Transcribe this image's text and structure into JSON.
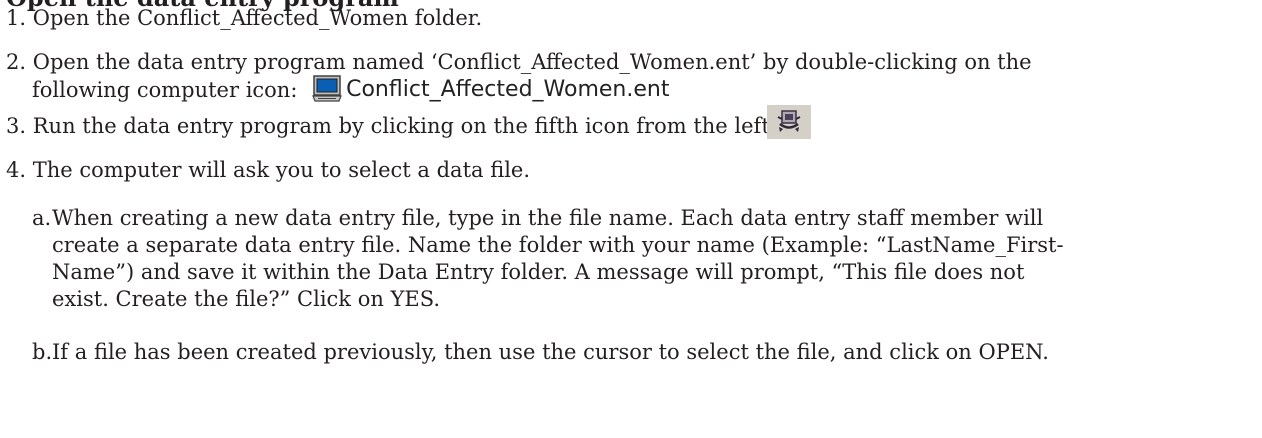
{
  "heading": "Open the data entry program",
  "steps": [
    {
      "num": "1.",
      "text": "Open the Conflict_Affected_Women folder."
    },
    {
      "num": "2.",
      "text": "Open the data entry program named ‘Conflict_Affected_Women.ent’ by double-clicking on the",
      "text_cont": "following computer icon:",
      "icon_label": "Conflict_Affected_Women.ent",
      "icon": "computer-icon"
    },
    {
      "num": "3.",
      "text": "Run the data entry program by clicking on the fifth icon from the left:",
      "icon": "run-program-icon"
    },
    {
      "num": "4.",
      "text": "The computer will ask you to select a data file."
    }
  ],
  "substeps": [
    {
      "label": "a.",
      "lines": [
        "When creating a new data entry file, type in the file name. Each data entry staff member will",
        "create a separate data entry file. Name the folder with your name (Example: “LastName_First-",
        "Name”) and save it within the Data Entry folder. A message will prompt, “This file does not",
        "exist. Create the file?” Click on YES."
      ]
    },
    {
      "label": "b.",
      "lines": [
        "If a file has been created previously, then use the cursor to select the file, and click on OPEN."
      ]
    }
  ]
}
